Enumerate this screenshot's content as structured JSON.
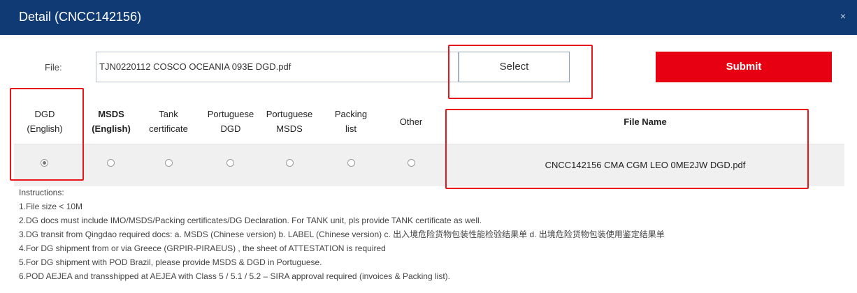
{
  "dialog": {
    "title": "Detail (CNCC142156)",
    "close_glyph": "×"
  },
  "file_row": {
    "label": "File:",
    "value": "TJN0220112 COSCO OCEANIA 093E  DGD.pdf",
    "select_label": "Select",
    "submit_label": "Submit"
  },
  "doc_types": [
    {
      "label_line1": "DGD",
      "label_line2": "(English)",
      "selected": true
    },
    {
      "label_line1": "MSDS",
      "label_line2": "(English)",
      "selected": false
    },
    {
      "label_line1": "Tank",
      "label_line2": "certificate",
      "selected": false
    },
    {
      "label_line1": "Portuguese",
      "label_line2": "DGD",
      "selected": false
    },
    {
      "label_line1": "Portuguese",
      "label_line2": "MSDS",
      "selected": false
    },
    {
      "label_line1": "Packing",
      "label_line2": "list",
      "selected": false
    },
    {
      "label_line1": "Other",
      "label_line2": "",
      "selected": false
    }
  ],
  "file_name": {
    "header": "File Name",
    "value": "CNCC142156 CMA CGM LEO 0ME2JW DGD.pdf"
  },
  "instructions": {
    "heading": "Instructions:",
    "items": [
      "1.File size < 10M",
      "2.DG docs must include IMO/MSDS/Packing certificates/DG Declaration. For TANK unit, pls provide TANK certificate as well.",
      "3.DG transit from Qingdao required docs: a. MSDS  (Chinese version)  b. LABEL  (Chinese version)  c. 出入境危险货物包装性能检验结果单 d. 出境危险货物包装使用鉴定结果单",
      "4.For DG shipment from or via Greece  (GRPIR-PIRAEUS) , the sheet of ATTESTATION is required",
      "5.For DG shipment with POD Brazil, please provide MSDS & DGD in Portuguese.",
      "6.POD AEJEA and transshipped at AEJEA with Class 5 / 5.1 / 5.2 – SIRA approval required (invoices & Packing list)."
    ]
  },
  "colors": {
    "titlebar": "#0f3a73",
    "submit": "#e60012",
    "highlight_box": "#e8151b",
    "row_background": "#f0f0f0"
  }
}
